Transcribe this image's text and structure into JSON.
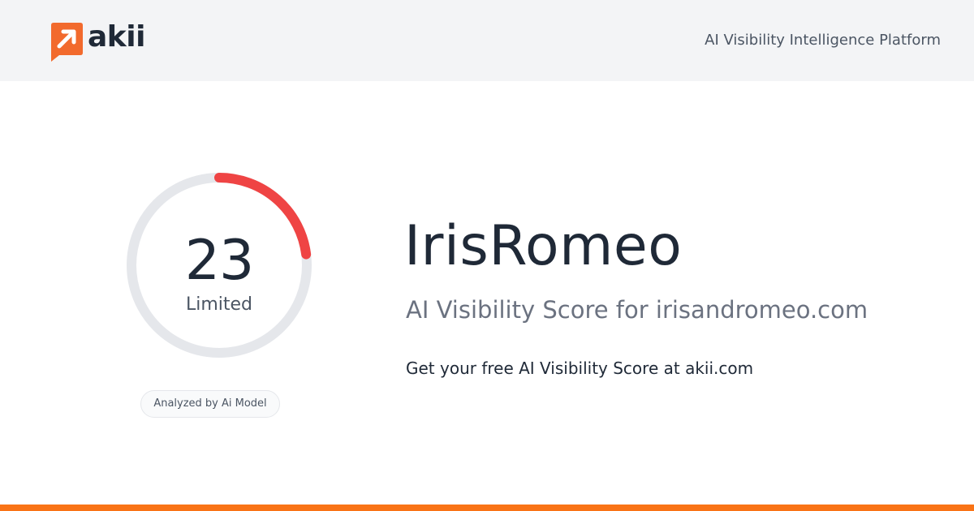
{
  "brand": {
    "logo_text": "akii",
    "tagline": "AI Visibility Intelligence Platform",
    "accent_color": "#f26a2d"
  },
  "score": {
    "value": "23",
    "max": 100,
    "label": "Limited",
    "arc_color": "#ef4444",
    "track_color": "#e5e7eb",
    "badge": "Analyzed by Ai Model"
  },
  "report": {
    "name": "IrisRomeo",
    "subtitle": "AI Visibility Score for irisandromeo.com",
    "cta": "Get your free AI Visibility Score at akii.com"
  },
  "footer": {
    "bar_color": "#f97316"
  }
}
